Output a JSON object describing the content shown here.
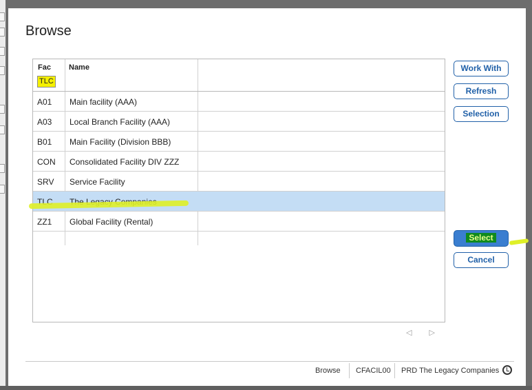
{
  "dialog": {
    "title": "Browse"
  },
  "grid": {
    "columns": [
      "Fac",
      "Name"
    ],
    "filter_value": "TLC",
    "rows": [
      {
        "fac": "A01",
        "name": "Main facility (AAA)"
      },
      {
        "fac": "A03",
        "name": "Local Branch Facility (AAA)"
      },
      {
        "fac": "B01",
        "name": "Main Facility (Division BBB)"
      },
      {
        "fac": "CON",
        "name": "Consolidated Facility DIV ZZZ"
      },
      {
        "fac": "SRV",
        "name": "Service Facility"
      },
      {
        "fac": "TLC",
        "name": "The Legacy Companies"
      },
      {
        "fac": "ZZ1",
        "name": "Global Facility (Rental)"
      }
    ],
    "selected_row": 5
  },
  "pager": {
    "prev": "◁",
    "next": "▷"
  },
  "buttons": {
    "work_with": "Work With",
    "refresh": "Refresh",
    "selection": "Selection",
    "select": "Select",
    "cancel": "Cancel"
  },
  "status": {
    "mode": "Browse",
    "program": "CFACIL00",
    "environment": "PRD The Legacy Companies"
  },
  "colors": {
    "accent": "#2060a8",
    "selected_row": "#c4ddf5",
    "highlight": "#dff028"
  }
}
